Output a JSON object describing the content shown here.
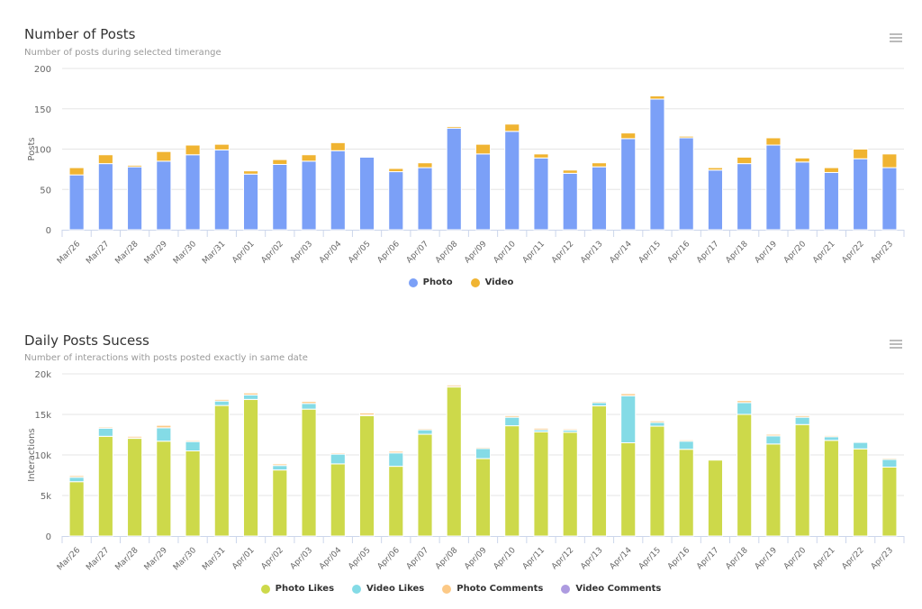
{
  "chart_data": [
    {
      "type": "bar",
      "stacked": true,
      "title": "Number of Posts",
      "subtitle": "Number of posts during selected timerange",
      "xlabel": "",
      "ylabel": "Posts",
      "ylim": [
        0,
        200
      ],
      "yticks": [
        0,
        50,
        100,
        150,
        200
      ],
      "ytick_labels": [
        "0",
        "50",
        "100",
        "150",
        "200"
      ],
      "grid": true,
      "legend_position": "bottom-center",
      "categories": [
        "Mar/26",
        "Mar/27",
        "Mar/28",
        "Mar/29",
        "Mar/30",
        "Mar/31",
        "Apr/01",
        "Apr/02",
        "Apr/03",
        "Apr/04",
        "Apr/05",
        "Apr/06",
        "Apr/07",
        "Apr/08",
        "Apr/09",
        "Apr/10",
        "Apr/11",
        "Apr/12",
        "Apr/13",
        "Apr/14",
        "Apr/15",
        "Apr/16",
        "Apr/17",
        "Apr/18",
        "Apr/19",
        "Apr/20",
        "Apr/21",
        "Apr/22",
        "Apr/23"
      ],
      "series": [
        {
          "name": "Photo",
          "color": "#7ba0f7",
          "values": [
            68,
            82,
            78,
            85,
            93,
            99,
            69,
            81,
            85,
            98,
            90,
            72,
            77,
            126,
            94,
            122,
            89,
            70,
            78,
            113,
            162,
            114,
            74,
            82,
            105,
            84,
            71,
            88,
            77
          ]
        },
        {
          "name": "Video",
          "color": "#f0b432",
          "values": [
            9,
            11,
            2,
            12,
            12,
            7,
            4,
            6,
            8,
            10,
            1,
            4,
            6,
            2,
            12,
            9,
            5,
            4,
            5,
            7,
            4,
            2,
            3,
            8,
            9,
            5,
            6,
            12,
            17
          ]
        }
      ]
    },
    {
      "type": "bar",
      "stacked": true,
      "title": "Daily Posts Sucess",
      "subtitle": "Number of interactions with posts posted exactly in same date",
      "xlabel": "",
      "ylabel": "Interactions",
      "ylim": [
        0,
        20000
      ],
      "yticks": [
        0,
        5000,
        10000,
        15000,
        20000
      ],
      "ytick_labels": [
        "0",
        "5k",
        "10k",
        "15k",
        "20k"
      ],
      "grid": true,
      "legend_position": "bottom-center",
      "categories": [
        "Mar/26",
        "Mar/27",
        "Mar/28",
        "Mar/29",
        "Mar/30",
        "Mar/31",
        "Apr/01",
        "Apr/02",
        "Apr/03",
        "Apr/04",
        "Apr/05",
        "Apr/06",
        "Apr/07",
        "Apr/08",
        "Apr/09",
        "Apr/10",
        "Apr/11",
        "Apr/12",
        "Apr/13",
        "Apr/14",
        "Apr/15",
        "Apr/16",
        "Apr/17",
        "Apr/18",
        "Apr/19",
        "Apr/20",
        "Apr/21",
        "Apr/22",
        "Apr/23"
      ],
      "series": [
        {
          "name": "Photo Likes",
          "color": "#cdd94a",
          "values": [
            6700,
            12300,
            12050,
            11700,
            10500,
            16100,
            16850,
            8150,
            15650,
            8900,
            14850,
            8600,
            12550,
            18400,
            9550,
            13600,
            12850,
            12800,
            16050,
            11500,
            13550,
            10700,
            9400,
            15000,
            11350,
            13750,
            11800,
            10750,
            8500
          ]
        },
        {
          "name": "Video Likes",
          "color": "#84dbe6",
          "values": [
            550,
            1000,
            50,
            1650,
            1150,
            550,
            550,
            550,
            700,
            1200,
            80,
            1650,
            550,
            30,
            1250,
            1050,
            250,
            250,
            400,
            5800,
            450,
            1000,
            20,
            1450,
            1000,
            900,
            450,
            800,
            950
          ]
        },
        {
          "name": "Photo Comments",
          "color": "#fcc986",
          "values": [
            250,
            200,
            200,
            350,
            200,
            250,
            300,
            250,
            300,
            200,
            250,
            250,
            200,
            200,
            200,
            250,
            200,
            150,
            200,
            300,
            250,
            200,
            100,
            300,
            250,
            250,
            150,
            150,
            200
          ]
        },
        {
          "name": "Video Comments",
          "color": "#ad9be0",
          "values": [
            5,
            5,
            0,
            10,
            5,
            5,
            5,
            5,
            5,
            5,
            0,
            10,
            5,
            0,
            5,
            5,
            0,
            0,
            5,
            20,
            5,
            5,
            0,
            10,
            5,
            5,
            0,
            5,
            5
          ]
        }
      ]
    }
  ]
}
